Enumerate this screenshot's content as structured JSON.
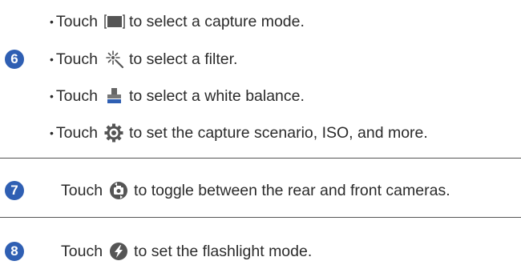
{
  "steps": {
    "step6": {
      "number": "6",
      "items": [
        {
          "bullet": "•",
          "prefix": "Touch",
          "icon": "capture-mode-icon",
          "text": "to select a capture mode."
        },
        {
          "bullet": "•",
          "prefix": "Touch",
          "icon": "filter-icon",
          "text": "to select a filter."
        },
        {
          "bullet": "•",
          "prefix": "Touch",
          "icon": "white-balance-icon",
          "text": "to select a white balance."
        },
        {
          "bullet": "•",
          "prefix": "Touch",
          "icon": "settings-gear-icon",
          "text": "to set the capture scenario, ISO, and more."
        }
      ]
    },
    "step7": {
      "number": "7",
      "prefix": "Touch",
      "icon": "switch-camera-icon",
      "text": "to toggle between the rear and front cameras."
    },
    "step8": {
      "number": "8",
      "prefix": "Touch",
      "icon": "flash-icon",
      "text": "to set the flashlight mode."
    }
  },
  "colors": {
    "step_badge": "#2f5fb3",
    "text": "#2b2b2b",
    "icon": "#555555",
    "divider": "#555555"
  }
}
